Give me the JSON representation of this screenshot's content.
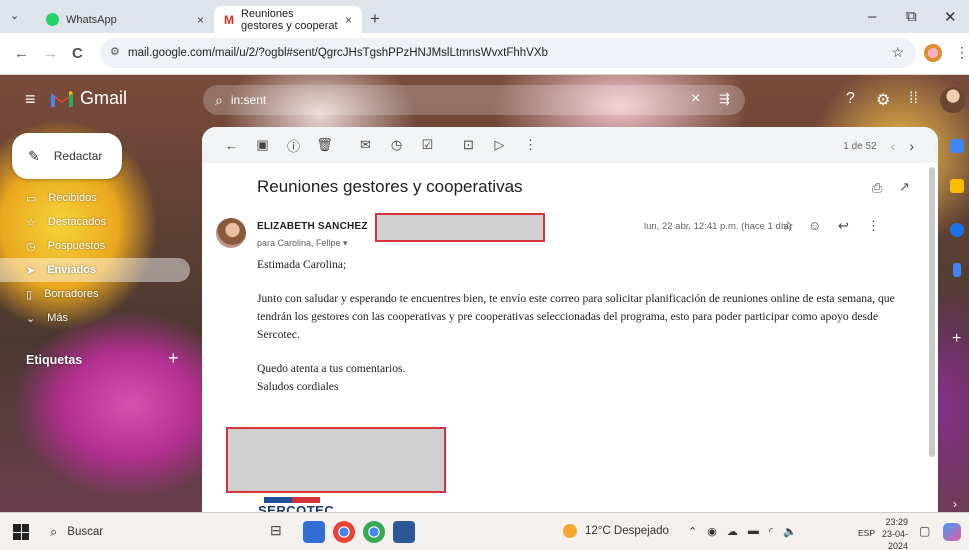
{
  "browser": {
    "tabs": [
      {
        "title": "WhatsApp",
        "close": "×"
      },
      {
        "title": "Reuniones gestores y cooperat",
        "close": "×"
      }
    ],
    "new_tab": "+",
    "window_controls": {
      "minimize": "–",
      "restore": "⧉",
      "close": "✕"
    },
    "nav": {
      "back": "←",
      "forward": "→",
      "reload": "C"
    },
    "url": "mail.google.com/mail/u/2/?ogbl#sent/QgrcJHsTgshPPzHNJMslLtmnsWvxtFhhVXb"
  },
  "gmail": {
    "logo_text": "Gmail",
    "search": {
      "value": "in:sent",
      "clear": "×"
    },
    "compose_label": "Redactar",
    "nav_items": [
      {
        "label": "Recibidos",
        "icon": "inbox-icon"
      },
      {
        "label": "Destacados",
        "icon": "star-icon"
      },
      {
        "label": "Pospuestos",
        "icon": "clock-icon"
      },
      {
        "label": "Enviados",
        "icon": "send-icon",
        "active": true
      },
      {
        "label": "Borradores",
        "icon": "file-icon"
      },
      {
        "label": "Más",
        "icon": "chevron-down-icon"
      }
    ],
    "labels_header": "Etiquetas",
    "labels_add": "+"
  },
  "message": {
    "pager": {
      "text": "1 de 52",
      "prev": "‹",
      "next": "›"
    },
    "subject": "Reuniones gestores y cooperativas",
    "sender_name": "ELIZABETH SANCHEZ",
    "recipients": "para Carolina, Felipe ▾",
    "date": "lun, 22 abr, 12:41 p.m. (hace 1 día)",
    "body": {
      "greeting": "Estimada Carolina;",
      "paragraph": "Junto con saludar y esperando te encuentres bien, te envío este correo para solicitar planificación de reuniones online de esta semana, que tendrán los gestores con las cooperativas y pre cooperativas seleccionadas del programa, esto para poder participar como apoyo desde Sercotec.",
      "closing1": "Quedo atenta a tus comentarios.",
      "closing2": "Saludos cordiales"
    },
    "signature_logo": "SERCOTEC"
  },
  "taskbar": {
    "search_placeholder": "Buscar",
    "weather": "12°C Despejado",
    "language": "ESP",
    "time": "23:29",
    "date": "23-04-2024"
  },
  "colors": {
    "accent_red": "#d6323c",
    "redaction": "#d0d0d0",
    "sercotec_blue": "#1f3a6e"
  }
}
